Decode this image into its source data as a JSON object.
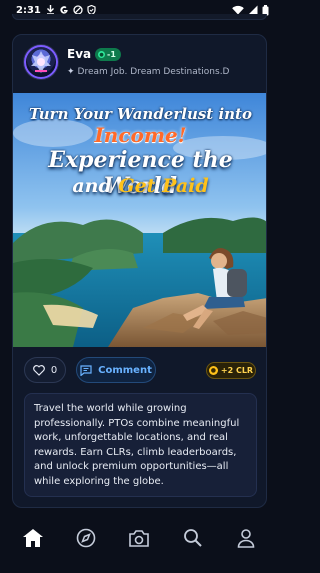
{
  "status_bar": {
    "time": "2:31",
    "icons": [
      "download-icon",
      "google-icon",
      "do-not-disturb-icon",
      "shield-icon"
    ],
    "right_icons": [
      "wifi-icon",
      "signal-icon",
      "battery-icon"
    ]
  },
  "post": {
    "user": {
      "name": "Eva",
      "badge_value": "-1",
      "subtitle_icon": "sparkle-icon",
      "subtitle": "Dream Job. Dream Destinations.D"
    },
    "image": {
      "headline_line1": "Turn Your Wanderlust into",
      "headline_line2": "Income!",
      "headline_line3": "Experience the World",
      "headline_line4_a": "and ",
      "headline_line4_b": "Get Paid"
    },
    "actions": {
      "like_count": "0",
      "comment_label": "Comment",
      "clr_reward": "+2 CLR"
    },
    "description": "Travel the world while growing professionally. PTOs combine meaningful work, unforgettable locations, and real rewards. Earn CLRs, climb leaderboards, and unlock premium opportunities—all while exploring the globe."
  },
  "bottom_nav": {
    "items": [
      "home-icon",
      "compass-icon",
      "camera-icon",
      "search-icon",
      "profile-icon"
    ],
    "active": "home-icon"
  },
  "colors": {
    "background": "#0b0f1a",
    "card": "#10182a",
    "accent_blue": "#69b2ff",
    "accent_gold": "#ffc21a",
    "badge_green": "#0e7a4c"
  }
}
